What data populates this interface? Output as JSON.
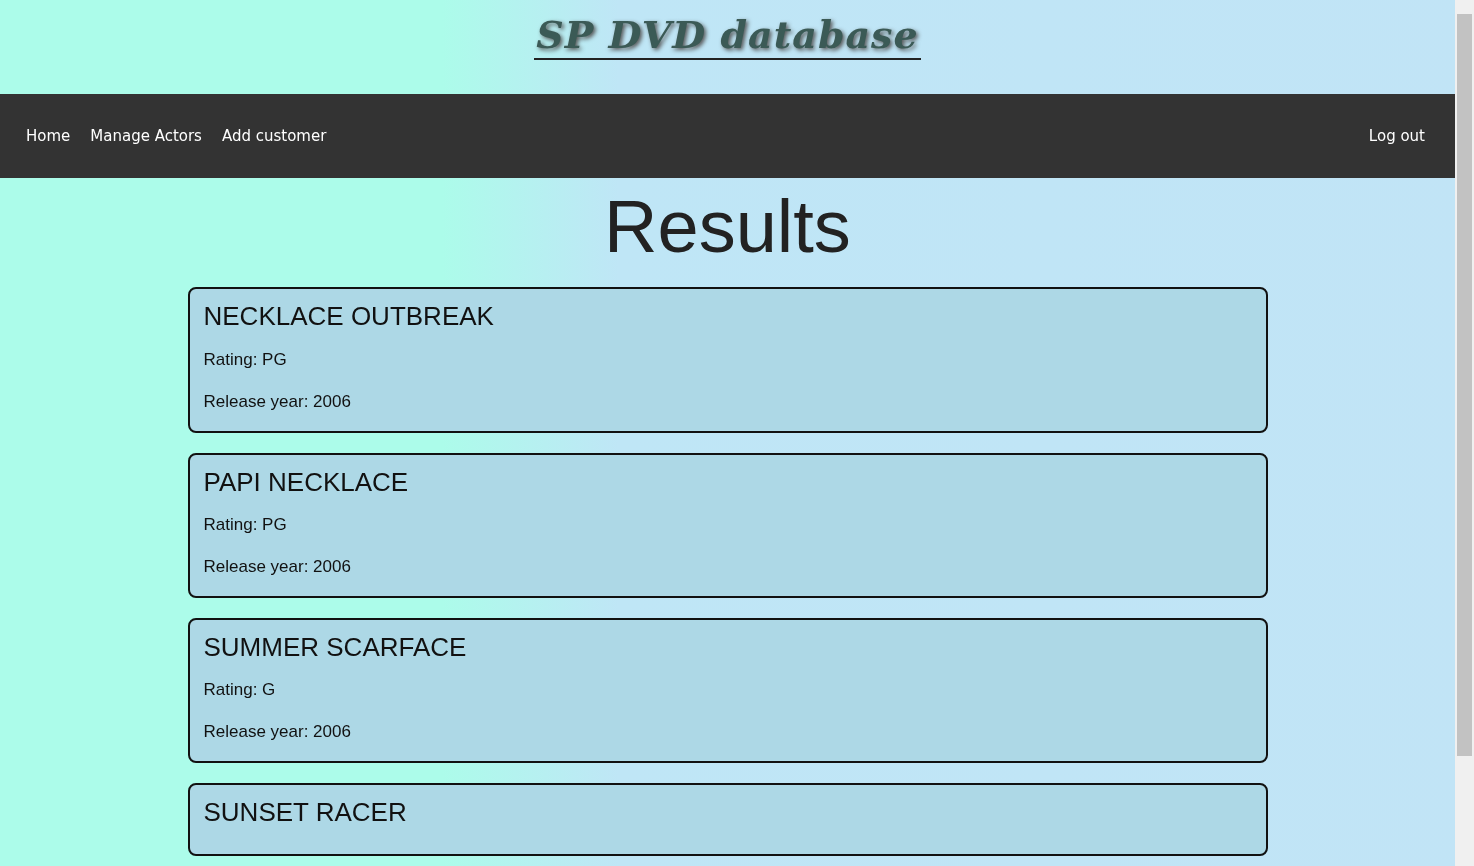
{
  "site_title": "SP DVD database",
  "nav": {
    "links": [
      {
        "label": "Home"
      },
      {
        "label": "Manage Actors"
      },
      {
        "label": "Add customer"
      }
    ],
    "right_link": {
      "label": "Log out"
    }
  },
  "heading": "Results",
  "films": [
    {
      "title": "NECKLACE OUTBREAK",
      "rating": "Rating: PG",
      "release": "Release year: 2006"
    },
    {
      "title": "PAPI NECKLACE",
      "rating": "Rating: PG",
      "release": "Release year: 2006"
    },
    {
      "title": "SUMMER SCARFACE",
      "rating": "Rating: G",
      "release": "Release year: 2006"
    },
    {
      "title": "SUNSET RACER"
    }
  ]
}
